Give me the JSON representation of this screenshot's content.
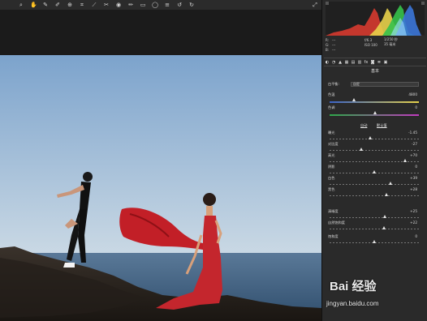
{
  "toolbar": {
    "icons": [
      "zoom-icon",
      "hand-icon",
      "white-balance-icon",
      "color-sampler-icon",
      "target-adjust-icon",
      "crop-icon",
      "straighten-icon",
      "spot-removal-icon",
      "redeye-icon",
      "adjustment-brush-icon",
      "graduated-filter-icon",
      "radial-filter-icon",
      "preferences-icon",
      "rotate-ccw-icon",
      "rotate-cw-icon"
    ],
    "right_icon": "fullscreen-icon"
  },
  "info": {
    "r_label": "R:",
    "r_value": "---",
    "g_label": "G:",
    "g_value": "---",
    "b_label": "B:",
    "b_value": "---",
    "aperture": "f/6.3",
    "shutter": "1/250 秒",
    "iso": "ISO 100",
    "focal": "35 毫米"
  },
  "panel": {
    "section_title": "基本",
    "white_balance_label": "白平衡:",
    "white_balance_value": "自定",
    "temperature_label": "色温",
    "temperature_value": "4800",
    "tint_label": "色调",
    "tint_value": "0",
    "auto_label": "自动",
    "default_label": "默认值",
    "sliders": [
      {
        "label": "曝光",
        "value": "-1.45",
        "pos": 0.46
      },
      {
        "label": "对比度",
        "value": "-27",
        "pos": 0.36
      },
      {
        "label": "高光",
        "value": "+70",
        "pos": 0.85
      },
      {
        "label": "阴影",
        "value": "0",
        "pos": 0.5
      },
      {
        "label": "白色",
        "value": "+39",
        "pos": 0.69
      },
      {
        "label": "黑色",
        "value": "+28",
        "pos": 0.64
      }
    ],
    "presence_sliders": [
      {
        "label": "清晰度",
        "value": "+25",
        "pos": 0.62
      },
      {
        "label": "自然饱和度",
        "value": "+22",
        "pos": 0.61
      },
      {
        "label": "饱和度",
        "value": "0",
        "pos": 0.5
      }
    ]
  },
  "watermark": {
    "brand": "Bai 经验",
    "url": "jingyan.baidu.com"
  },
  "colors": {
    "sky_top": "#7ea4cc",
    "sky_bottom": "#c4d5e3",
    "sea": "#3f5f80",
    "dress": "#c4262d",
    "rock": "#2b2520"
  }
}
